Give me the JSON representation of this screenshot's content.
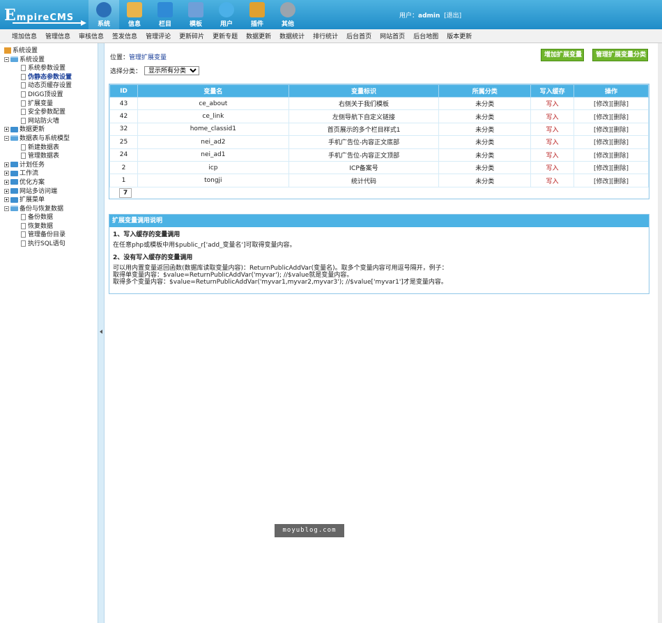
{
  "header": {
    "logo_big": "E",
    "logo_rest": "mpireCMS",
    "nav": [
      {
        "label": "系统",
        "icon": "globe-icon",
        "color": "#2b6fb8",
        "active": true
      },
      {
        "label": "信息",
        "icon": "document-edit-icon",
        "color": "#e9b44c",
        "active": false
      },
      {
        "label": "栏目",
        "icon": "folder-icon",
        "color": "#2f8ad6",
        "active": false
      },
      {
        "label": "模板",
        "icon": "window-icon",
        "color": "#6f9fd8",
        "active": false
      },
      {
        "label": "用户",
        "icon": "user-icon",
        "color": "#4bb0e8",
        "active": false
      },
      {
        "label": "插件",
        "icon": "tools-icon",
        "color": "#e0a030",
        "active": false
      },
      {
        "label": "其他",
        "icon": "gear-icon",
        "color": "#9aa4ae",
        "active": false
      }
    ],
    "user_prefix": "用户：",
    "username": "admin",
    "logout": "[退出]"
  },
  "submenu": [
    "增加信息",
    "管理信息",
    "审核信息",
    "签发信息",
    "管理评论",
    "更新碎片",
    "更新专题",
    "数据更新",
    "数据统计",
    "排行统计",
    "后台首页",
    "网站首页",
    "后台地图",
    "版本更新"
  ],
  "sidebar": {
    "root": "系统设置",
    "groups": [
      {
        "label": "系统设置",
        "open": true,
        "children": [
          "系统参数设置",
          "伪静态参数设置",
          "动态页缓存设置",
          "DIGG顶设置",
          "扩展变量",
          "安全参数配置",
          "网站防火墙"
        ]
      },
      {
        "label": "数据更新",
        "open": false,
        "children": []
      },
      {
        "label": "数据表与系统模型",
        "open": true,
        "children": [
          "新建数据表",
          "管理数据表"
        ]
      },
      {
        "label": "计划任务",
        "open": false,
        "children": []
      },
      {
        "label": "工作流",
        "open": false,
        "children": []
      },
      {
        "label": "优化方案",
        "open": false,
        "children": []
      },
      {
        "label": "网站多访问端",
        "open": false,
        "children": []
      },
      {
        "label": "扩展菜单",
        "open": false,
        "children": []
      },
      {
        "label": "备份与恢复数据",
        "open": true,
        "children": [
          "备份数据",
          "恢复数据",
          "管理备份目录",
          "执行SQL语句"
        ]
      }
    ],
    "current": "伪静态参数设置"
  },
  "main": {
    "location_prefix": "位置：",
    "location_link": "管理扩展变量",
    "btn_add": "增加扩展变量",
    "btn_manage": "管理扩展变量分类",
    "filter_label": "选择分类：",
    "filter_value": "显示所有分类",
    "table": {
      "headers": [
        "ID",
        "变量名",
        "变量标识",
        "所属分类",
        "写入缓存",
        "操作"
      ],
      "rows": [
        {
          "id": "43",
          "name": "ce_about",
          "label": "右侧关于我们模板",
          "category": "未分类",
          "cache": "写入",
          "edit": "[修改]",
          "del": "[删除]"
        },
        {
          "id": "42",
          "name": "ce_link",
          "label": "左侧导航下自定义链接",
          "category": "未分类",
          "cache": "写入",
          "edit": "[修改]",
          "del": "[删除]"
        },
        {
          "id": "32",
          "name": "home_classid1",
          "label": "首页展示的多个栏目样式1",
          "category": "未分类",
          "cache": "写入",
          "edit": "[修改]",
          "del": "[删除]"
        },
        {
          "id": "25",
          "name": "nei_ad2",
          "label": "手机广告位-内容正文底部",
          "category": "未分类",
          "cache": "写入",
          "edit": "[修改]",
          "del": "[删除]"
        },
        {
          "id": "24",
          "name": "nei_ad1",
          "label": "手机广告位-内容正文顶部",
          "category": "未分类",
          "cache": "写入",
          "edit": "[修改]",
          "del": "[删除]"
        },
        {
          "id": "2",
          "name": "icp",
          "label": "ICP备案号",
          "category": "未分类",
          "cache": "写入",
          "edit": "[修改]",
          "del": "[删除]"
        },
        {
          "id": "1",
          "name": "tongji",
          "label": "统计代码",
          "category": "未分类",
          "cache": "写入",
          "edit": "[修改]",
          "del": "[删除]"
        }
      ],
      "page": "7"
    },
    "help": {
      "title": "扩展变量调用说明",
      "s1_title": "1、写入缓存的变量调用",
      "s1_text": "在任意php或模板中用$public_r['add_变量名']可取得变量内容。",
      "s2_title": "2、没有写入缓存的变量调用",
      "s2_line1": "可以用内置变量返回函数(数据库读取变量内容)：ReturnPublicAddVar(变量名)。取多个变量内容可用逗号隔开，例子：",
      "s2_line2": "取得单变量内容：$value=ReturnPublicAddVar('myvar'); //$value就是变量内容。",
      "s2_line3": "取得多个变量内容：$value=ReturnPublicAddVar('myvar1,myvar2,myvar3'); //$value['myvar1']才是变量内容。"
    }
  },
  "watermark": "moyublog.com"
}
